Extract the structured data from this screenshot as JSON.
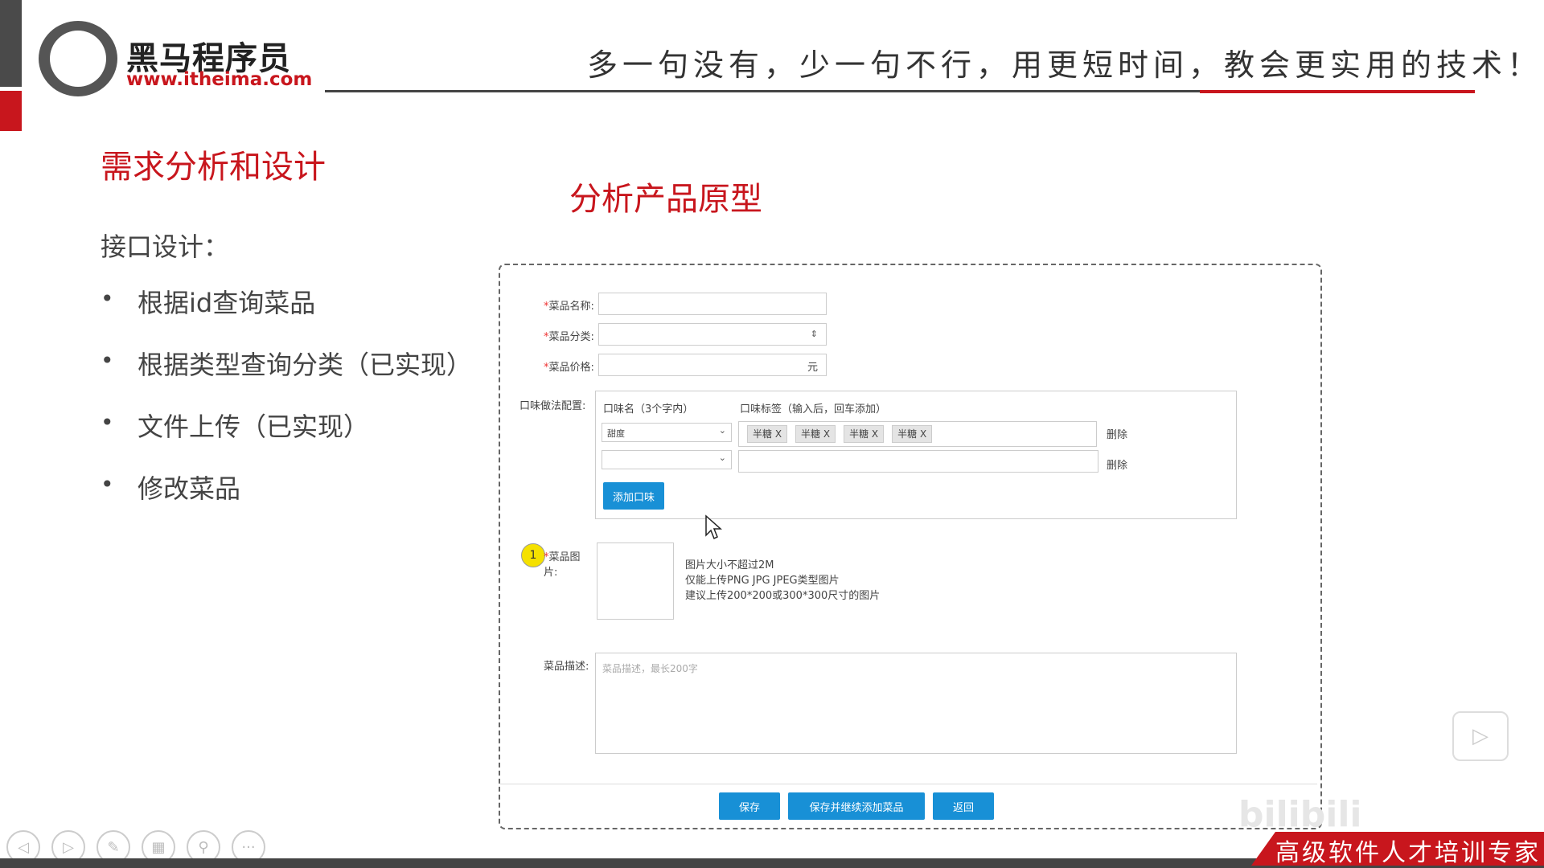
{
  "header": {
    "logo_name": "黑马程序员",
    "logo_url": "www.itheima.com",
    "slogan": "多一句没有，少一句不行，用更短时间，教会更实用的技术！"
  },
  "slide": {
    "section_title": "需求分析和设计",
    "subtitle": "接口设计：",
    "bullet": "•",
    "bullets": [
      "根据id查询菜品",
      "根据类型查询分类（已实现）",
      "文件上传（已实现）",
      "修改菜品"
    ],
    "center_title": "分析产品原型"
  },
  "form": {
    "asterisk": "*",
    "name_label": "菜品名称:",
    "category_label": "菜品分类:",
    "price_label": "菜品价格:",
    "price_unit": "元",
    "flavor_label": "口味做法配置:",
    "flavor_name_header": "口味名（3个字内）",
    "flavor_tag_header": "口味标签（输入后，回车添加）",
    "flavor_rows": [
      {
        "name": "甜度",
        "tags": [
          "半糖 X",
          "半糖 X",
          "半糖 X",
          "半糖 X"
        ],
        "delete": "删除"
      },
      {
        "name": "",
        "tags": [],
        "delete": "删除"
      }
    ],
    "add_flavor_button": "添加口味",
    "image_label": "菜品图片:",
    "image_hints": [
      "图片大小不超过2M",
      "仅能上传PNG JPG JPEG类型图片",
      "建议上传200*200或300*300尺寸的图片"
    ],
    "desc_label": "菜品描述:",
    "desc_placeholder": "菜品描述，最长200字",
    "save_button": "保存",
    "save_continue_button": "保存并继续添加菜品",
    "back_button": "返回",
    "badge": "1"
  },
  "footer": {
    "banner": "高级软件人才培训专家",
    "watermark": "bilibili"
  },
  "icons": {
    "controls": [
      "prev-icon",
      "next-icon",
      "pen-icon",
      "grid-icon",
      "zoom-icon",
      "more-icon"
    ],
    "control_glyphs": [
      "◁",
      "▷",
      "✎",
      "▦",
      "⚲",
      "···"
    ],
    "play": "▷",
    "select_arrow": "⇕",
    "dropdown_arrow": "⌄"
  },
  "colors": {
    "brand_red": "#c8161d",
    "button_blue": "#1890d6"
  }
}
